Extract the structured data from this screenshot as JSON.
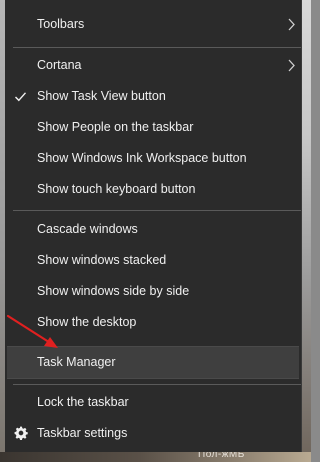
{
  "menu": {
    "items": {
      "toolbars": {
        "label": "Toolbars"
      },
      "cortana": {
        "label": "Cortana"
      },
      "show_task_view": {
        "label": "Show Task View button",
        "checked": true
      },
      "show_people": {
        "label": "Show People on the taskbar"
      },
      "show_ink": {
        "label": "Show Windows Ink Workspace button"
      },
      "show_touch_keyboard": {
        "label": "Show touch keyboard button"
      },
      "cascade": {
        "label": "Cascade windows"
      },
      "stacked": {
        "label": "Show windows stacked"
      },
      "side_by_side": {
        "label": "Show windows side by side"
      },
      "show_desktop": {
        "label": "Show the desktop"
      },
      "task_manager": {
        "label": "Task Manager",
        "highlighted": true
      },
      "lock_taskbar": {
        "label": "Lock the taskbar"
      },
      "taskbar_settings": {
        "label": "Taskbar settings"
      }
    }
  },
  "background": {
    "bottom_text": "Пол-жМБ"
  },
  "icons": {
    "submenu": "chevron-right-icon",
    "check": "checkmark-icon",
    "settings": "gear-icon",
    "pointer": "red-arrow-icon"
  },
  "colors": {
    "menu_bg": "#2b2b2b",
    "highlight_bg": "#3f3f3f",
    "text": "#f0f0f0",
    "separator": "#5a5a5a",
    "arrow": "#e02020"
  }
}
